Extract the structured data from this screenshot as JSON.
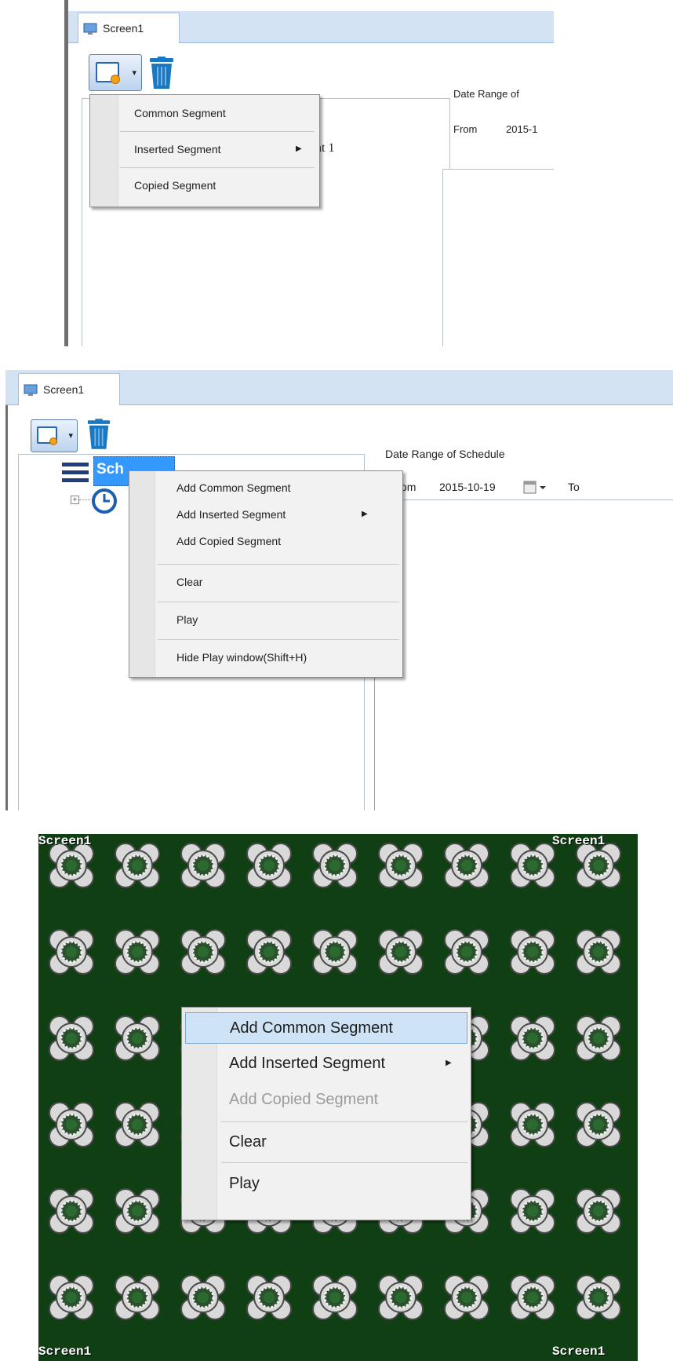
{
  "panel1": {
    "tab_label": "Screen1",
    "dropdown_menu": {
      "items": [
        "Common Segment",
        "Inserted Segment",
        "Copied Segment"
      ]
    },
    "list_partial_text": "nt 1",
    "date_range_label": "Date Range of",
    "from_label": "From",
    "from_value": "2015-1"
  },
  "panel2": {
    "tab_label": "Screen1",
    "tree_item_label": "Sch",
    "date_range_label": "Date Range of Schedule",
    "from_label": "om",
    "from_value": "2015-10-19",
    "to_label": "To",
    "context_menu": {
      "items": [
        "Add Common Segment",
        "Add Inserted Segment",
        "Add Copied Segment",
        "Clear",
        "Play",
        "Hide Play window(Shift+H)"
      ]
    }
  },
  "panel3": {
    "corner_labels": [
      "Screen1",
      "Screen1",
      "Screen1",
      "Screen1"
    ],
    "context_menu": {
      "items": [
        "Add Common Segment",
        "Add Inserted Segment",
        "Add Copied Segment",
        "Clear",
        "Play"
      ],
      "highlighted_item": "Add Common Segment",
      "disabled_item": "Add Copied Segment"
    }
  },
  "colors": {
    "tab_strip": "#d3e3f4",
    "pattern_background": "#113f14",
    "menu_highlight": "#cfe3f7",
    "selection": "#3399ff"
  },
  "icons": [
    "monitor-icon",
    "add-segment-icon",
    "trash-icon",
    "schedule-list-icon",
    "clock-icon",
    "expand-icon",
    "submenu-arrow-icon",
    "calendar-icon",
    "flower-tile-icon"
  ]
}
